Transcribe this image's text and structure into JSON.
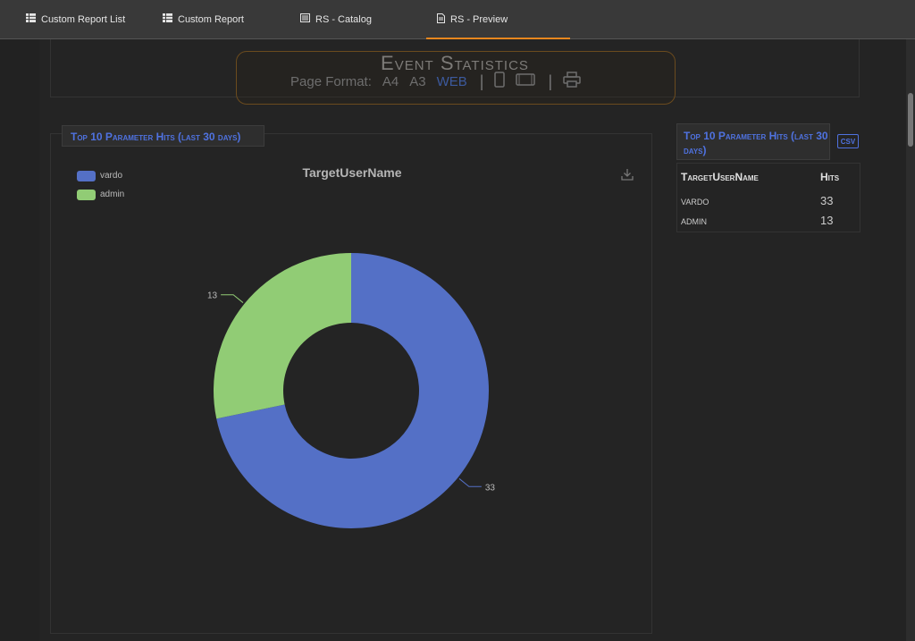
{
  "tabs": [
    {
      "label": "Custom Report List",
      "icon": "table-icon"
    },
    {
      "label": "Custom Report",
      "icon": "table-icon"
    },
    {
      "label": "RS - Catalog",
      "icon": "catalog-icon"
    },
    {
      "label": "RS - Preview",
      "icon": "document-icon",
      "active": true
    }
  ],
  "header": {
    "title": "Event Statistics",
    "page_format_label": "Page Format:",
    "formats": [
      "A4",
      "A3",
      "WEB"
    ],
    "selected_format": "WEB"
  },
  "chart_panel": {
    "title": "Top 10 Parameter Hits (last 30 days)"
  },
  "chart_data": {
    "type": "pie",
    "title": "TargetUserName",
    "donut": true,
    "categories": [
      "vardo",
      "admin"
    ],
    "values": [
      33,
      13
    ],
    "colors": [
      "#5470c6",
      "#91cc75"
    ],
    "legend_position": "top-left",
    "data_labels": [
      "33",
      "13"
    ]
  },
  "table_panel": {
    "title": "Top 10 Parameter Hits (last 30 days)",
    "csv_label": "CSV",
    "columns": [
      "TargetUserName",
      "Hits"
    ],
    "rows": [
      {
        "name": "VARDO",
        "hits": "33"
      },
      {
        "name": "ADMIN",
        "hits": "13"
      }
    ]
  },
  "colors": {
    "accent_orange": "#e8871e",
    "accent_blue": "#4f72e0"
  }
}
